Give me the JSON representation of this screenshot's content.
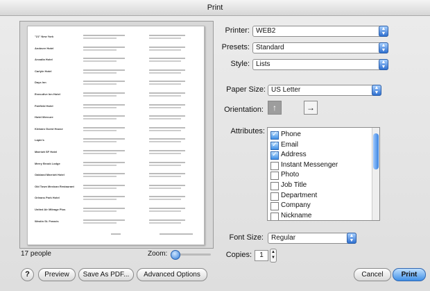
{
  "window": {
    "title": "Print"
  },
  "preview": {
    "rows": [
      {
        "name": "\"21\" New York"
      },
      {
        "name": "Andover Hotel"
      },
      {
        "name": "Arcadia Hotel"
      },
      {
        "name": "Carlyle Hotel"
      },
      {
        "name": "Days Inn"
      },
      {
        "name": "Executive Inn Hotel"
      },
      {
        "name": "Fairfield Hotel"
      },
      {
        "name": "Hotel Mercure"
      },
      {
        "name": "Kinkaro Guest House"
      },
      {
        "name": "Lapin's"
      },
      {
        "name": "Marriott SF Hotel"
      },
      {
        "name": "Merry Brook Lodge"
      },
      {
        "name": "Oakland Marriott Hotel"
      },
      {
        "name": "Old Town Mexican Restaurant"
      },
      {
        "name": "Orleans Park Hotel"
      },
      {
        "name": "United Air Mileage Plus"
      },
      {
        "name": "Westin St. Francis"
      }
    ],
    "people_count": "17 people",
    "zoom_label": "Zoom:"
  },
  "buttons": {
    "help": "?",
    "preview": "Preview",
    "save_pdf": "Save As PDF...",
    "advanced": "Advanced Options",
    "cancel": "Cancel",
    "print": "Print"
  },
  "settings": {
    "printer_label": "Printer:",
    "printer_value": "WEB2",
    "presets_label": "Presets:",
    "presets_value": "Standard",
    "style_label": "Style:",
    "style_value": "Lists",
    "paper_label": "Paper Size:",
    "paper_value": "US Letter",
    "orientation_label": "Orientation:",
    "attributes_label": "Attributes:",
    "attributes": [
      {
        "label": "Phone",
        "checked": true
      },
      {
        "label": "Email",
        "checked": true
      },
      {
        "label": "Address",
        "checked": true
      },
      {
        "label": "Instant Messenger",
        "checked": false
      },
      {
        "label": "Photo",
        "checked": false
      },
      {
        "label": "Job Title",
        "checked": false
      },
      {
        "label": "Department",
        "checked": false
      },
      {
        "label": "Company",
        "checked": false
      },
      {
        "label": "Nickname",
        "checked": false
      }
    ],
    "font_size_label": "Font Size:",
    "font_size_value": "Regular",
    "copies_label": "Copies:",
    "copies_value": "1"
  }
}
